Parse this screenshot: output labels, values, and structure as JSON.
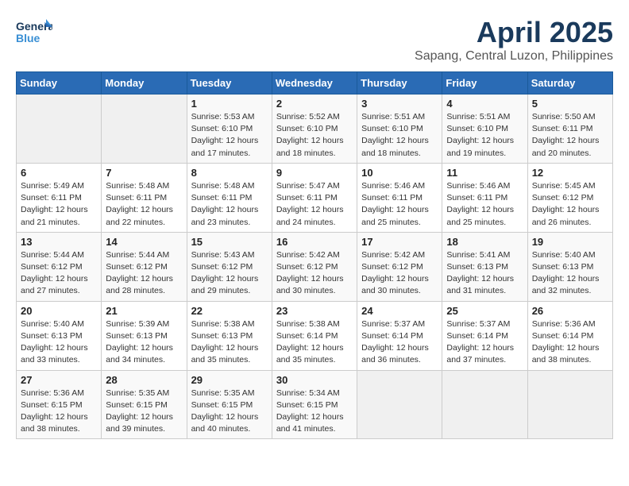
{
  "header": {
    "logo_general": "General",
    "logo_blue": "Blue",
    "title": "April 2025",
    "subtitle": "Sapang, Central Luzon, Philippines"
  },
  "days_of_week": [
    "Sunday",
    "Monday",
    "Tuesday",
    "Wednesday",
    "Thursday",
    "Friday",
    "Saturday"
  ],
  "weeks": [
    [
      {
        "day": "",
        "sunrise": "",
        "sunset": "",
        "daylight": ""
      },
      {
        "day": "",
        "sunrise": "",
        "sunset": "",
        "daylight": ""
      },
      {
        "day": "1",
        "sunrise": "Sunrise: 5:53 AM",
        "sunset": "Sunset: 6:10 PM",
        "daylight": "Daylight: 12 hours and 17 minutes."
      },
      {
        "day": "2",
        "sunrise": "Sunrise: 5:52 AM",
        "sunset": "Sunset: 6:10 PM",
        "daylight": "Daylight: 12 hours and 18 minutes."
      },
      {
        "day": "3",
        "sunrise": "Sunrise: 5:51 AM",
        "sunset": "Sunset: 6:10 PM",
        "daylight": "Daylight: 12 hours and 18 minutes."
      },
      {
        "day": "4",
        "sunrise": "Sunrise: 5:51 AM",
        "sunset": "Sunset: 6:10 PM",
        "daylight": "Daylight: 12 hours and 19 minutes."
      },
      {
        "day": "5",
        "sunrise": "Sunrise: 5:50 AM",
        "sunset": "Sunset: 6:11 PM",
        "daylight": "Daylight: 12 hours and 20 minutes."
      }
    ],
    [
      {
        "day": "6",
        "sunrise": "Sunrise: 5:49 AM",
        "sunset": "Sunset: 6:11 PM",
        "daylight": "Daylight: 12 hours and 21 minutes."
      },
      {
        "day": "7",
        "sunrise": "Sunrise: 5:48 AM",
        "sunset": "Sunset: 6:11 PM",
        "daylight": "Daylight: 12 hours and 22 minutes."
      },
      {
        "day": "8",
        "sunrise": "Sunrise: 5:48 AM",
        "sunset": "Sunset: 6:11 PM",
        "daylight": "Daylight: 12 hours and 23 minutes."
      },
      {
        "day": "9",
        "sunrise": "Sunrise: 5:47 AM",
        "sunset": "Sunset: 6:11 PM",
        "daylight": "Daylight: 12 hours and 24 minutes."
      },
      {
        "day": "10",
        "sunrise": "Sunrise: 5:46 AM",
        "sunset": "Sunset: 6:11 PM",
        "daylight": "Daylight: 12 hours and 25 minutes."
      },
      {
        "day": "11",
        "sunrise": "Sunrise: 5:46 AM",
        "sunset": "Sunset: 6:11 PM",
        "daylight": "Daylight: 12 hours and 25 minutes."
      },
      {
        "day": "12",
        "sunrise": "Sunrise: 5:45 AM",
        "sunset": "Sunset: 6:12 PM",
        "daylight": "Daylight: 12 hours and 26 minutes."
      }
    ],
    [
      {
        "day": "13",
        "sunrise": "Sunrise: 5:44 AM",
        "sunset": "Sunset: 6:12 PM",
        "daylight": "Daylight: 12 hours and 27 minutes."
      },
      {
        "day": "14",
        "sunrise": "Sunrise: 5:44 AM",
        "sunset": "Sunset: 6:12 PM",
        "daylight": "Daylight: 12 hours and 28 minutes."
      },
      {
        "day": "15",
        "sunrise": "Sunrise: 5:43 AM",
        "sunset": "Sunset: 6:12 PM",
        "daylight": "Daylight: 12 hours and 29 minutes."
      },
      {
        "day": "16",
        "sunrise": "Sunrise: 5:42 AM",
        "sunset": "Sunset: 6:12 PM",
        "daylight": "Daylight: 12 hours and 30 minutes."
      },
      {
        "day": "17",
        "sunrise": "Sunrise: 5:42 AM",
        "sunset": "Sunset: 6:12 PM",
        "daylight": "Daylight: 12 hours and 30 minutes."
      },
      {
        "day": "18",
        "sunrise": "Sunrise: 5:41 AM",
        "sunset": "Sunset: 6:13 PM",
        "daylight": "Daylight: 12 hours and 31 minutes."
      },
      {
        "day": "19",
        "sunrise": "Sunrise: 5:40 AM",
        "sunset": "Sunset: 6:13 PM",
        "daylight": "Daylight: 12 hours and 32 minutes."
      }
    ],
    [
      {
        "day": "20",
        "sunrise": "Sunrise: 5:40 AM",
        "sunset": "Sunset: 6:13 PM",
        "daylight": "Daylight: 12 hours and 33 minutes."
      },
      {
        "day": "21",
        "sunrise": "Sunrise: 5:39 AM",
        "sunset": "Sunset: 6:13 PM",
        "daylight": "Daylight: 12 hours and 34 minutes."
      },
      {
        "day": "22",
        "sunrise": "Sunrise: 5:38 AM",
        "sunset": "Sunset: 6:13 PM",
        "daylight": "Daylight: 12 hours and 35 minutes."
      },
      {
        "day": "23",
        "sunrise": "Sunrise: 5:38 AM",
        "sunset": "Sunset: 6:14 PM",
        "daylight": "Daylight: 12 hours and 35 minutes."
      },
      {
        "day": "24",
        "sunrise": "Sunrise: 5:37 AM",
        "sunset": "Sunset: 6:14 PM",
        "daylight": "Daylight: 12 hours and 36 minutes."
      },
      {
        "day": "25",
        "sunrise": "Sunrise: 5:37 AM",
        "sunset": "Sunset: 6:14 PM",
        "daylight": "Daylight: 12 hours and 37 minutes."
      },
      {
        "day": "26",
        "sunrise": "Sunrise: 5:36 AM",
        "sunset": "Sunset: 6:14 PM",
        "daylight": "Daylight: 12 hours and 38 minutes."
      }
    ],
    [
      {
        "day": "27",
        "sunrise": "Sunrise: 5:36 AM",
        "sunset": "Sunset: 6:15 PM",
        "daylight": "Daylight: 12 hours and 38 minutes."
      },
      {
        "day": "28",
        "sunrise": "Sunrise: 5:35 AM",
        "sunset": "Sunset: 6:15 PM",
        "daylight": "Daylight: 12 hours and 39 minutes."
      },
      {
        "day": "29",
        "sunrise": "Sunrise: 5:35 AM",
        "sunset": "Sunset: 6:15 PM",
        "daylight": "Daylight: 12 hours and 40 minutes."
      },
      {
        "day": "30",
        "sunrise": "Sunrise: 5:34 AM",
        "sunset": "Sunset: 6:15 PM",
        "daylight": "Daylight: 12 hours and 41 minutes."
      },
      {
        "day": "",
        "sunrise": "",
        "sunset": "",
        "daylight": ""
      },
      {
        "day": "",
        "sunrise": "",
        "sunset": "",
        "daylight": ""
      },
      {
        "day": "",
        "sunrise": "",
        "sunset": "",
        "daylight": ""
      }
    ]
  ]
}
